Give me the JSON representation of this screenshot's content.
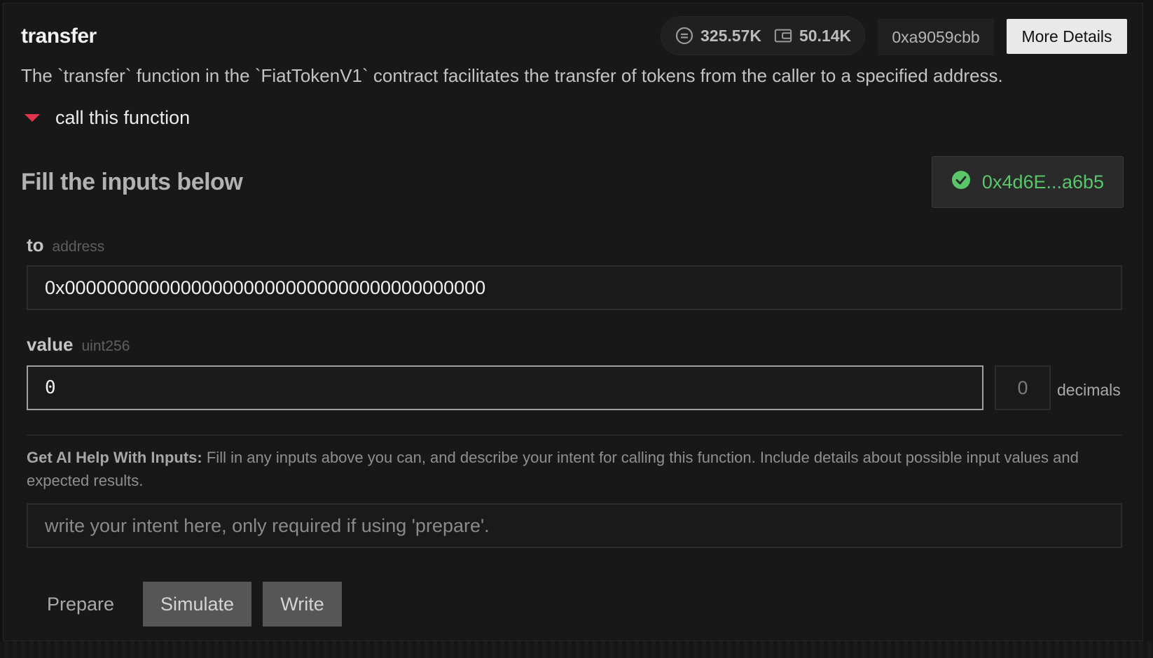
{
  "function": {
    "name": "transfer",
    "description": "The `transfer` function in the `FiatTokenV1` contract facilitates the transfer of tokens from the caller to a specified address."
  },
  "stats": {
    "calls": "325.57K",
    "wallets": "50.14K",
    "selector": "0xa9059cbb"
  },
  "header": {
    "more_details": "More Details"
  },
  "call_section": {
    "toggle_label": "call this function"
  },
  "form": {
    "title": "Fill the inputs below",
    "connected_address": "0x4d6E...a6b5",
    "params": [
      {
        "name": "to",
        "type": "address",
        "value": "0x0000000000000000000000000000000000000000"
      },
      {
        "name": "value",
        "type": "uint256",
        "value": "0"
      }
    ],
    "decimals_value": "0",
    "decimals_label": "decimals"
  },
  "ai_help": {
    "heading": "Get AI Help With Inputs:",
    "text": " Fill in any inputs above you can, and describe your intent for calling this function. Include details about possible input values and expected results.",
    "placeholder": "write your intent here, only required if using 'prepare'."
  },
  "actions": {
    "prepare": "Prepare",
    "simulate": "Simulate",
    "write": "Write"
  },
  "colors": {
    "accent_red": "#e2344d",
    "connected_green": "#5ac66a"
  }
}
